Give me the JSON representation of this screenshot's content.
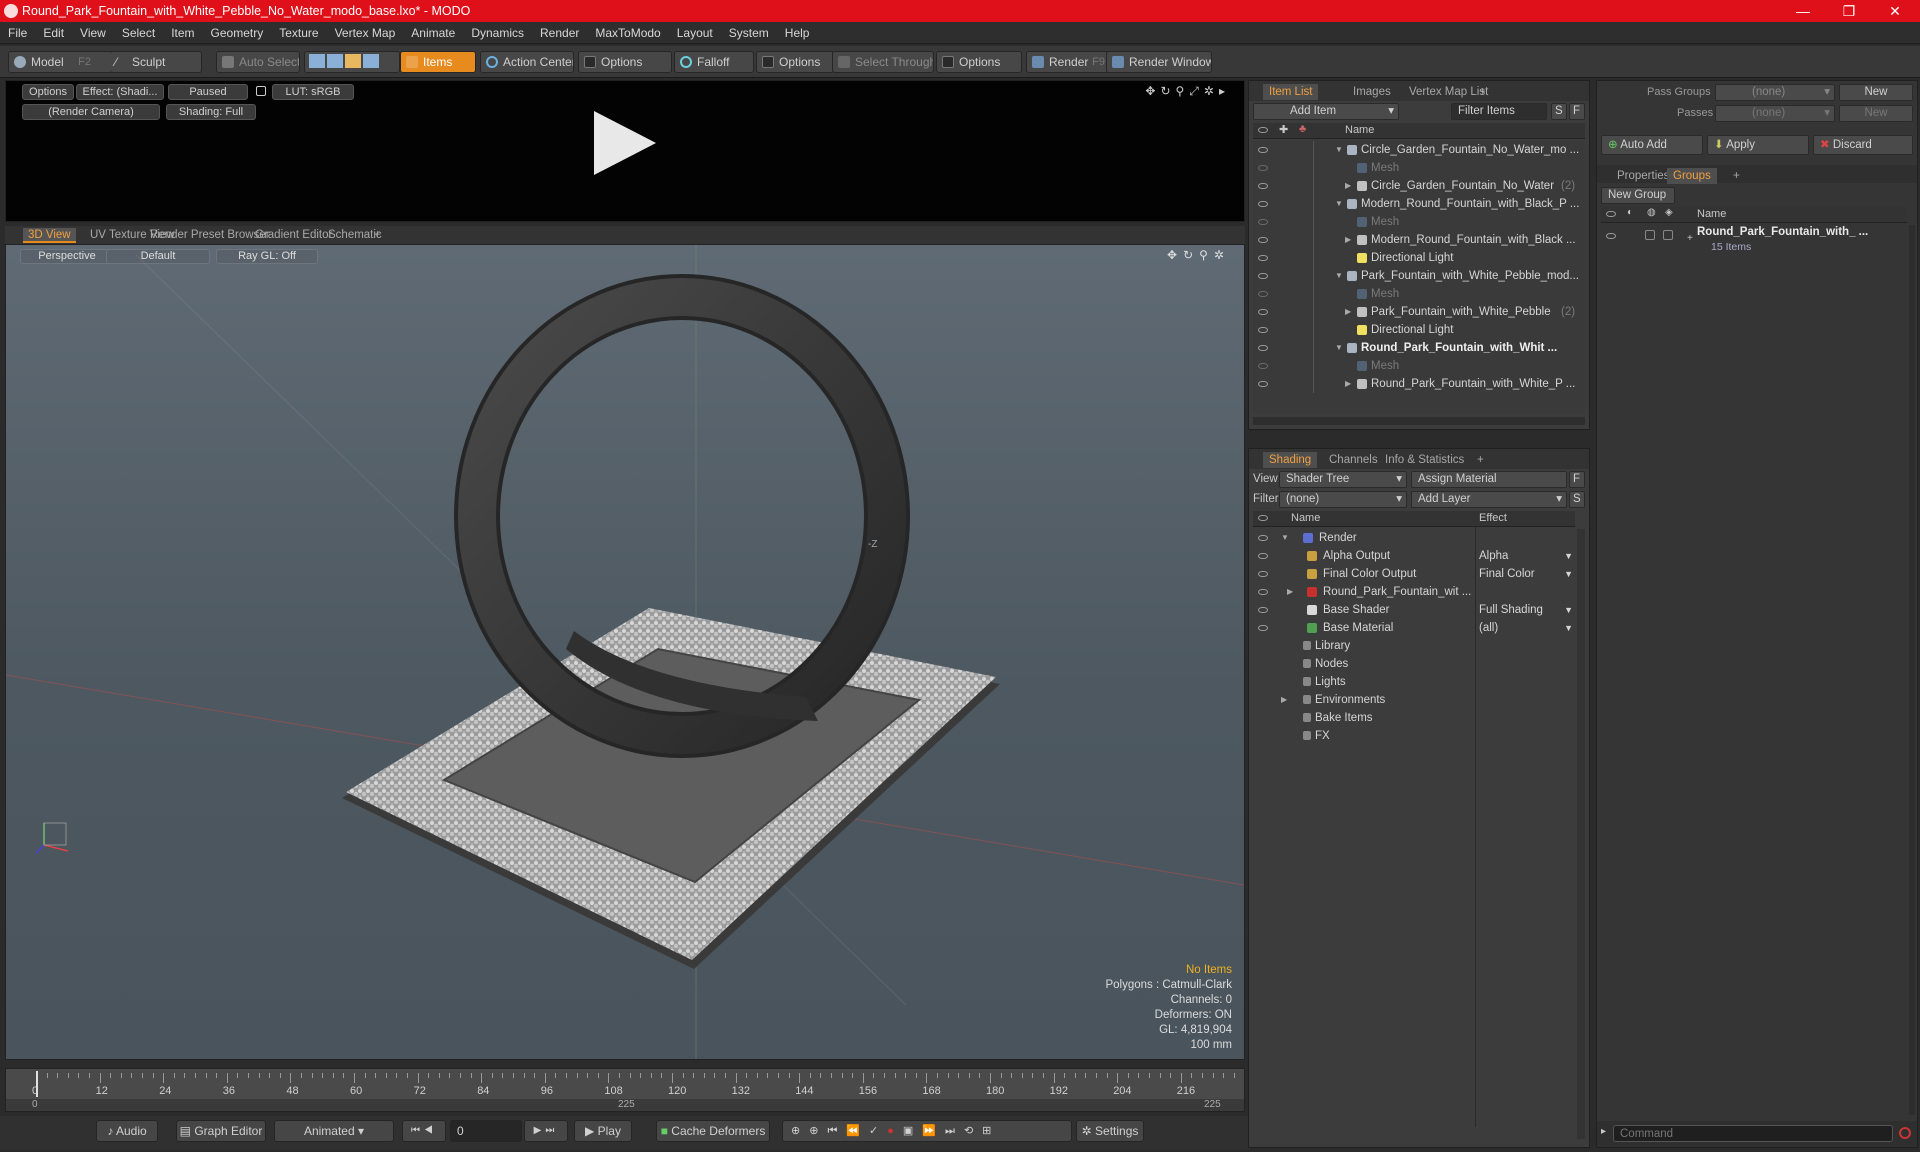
{
  "window": {
    "title": "Round_Park_Fountain_with_White_Pebble_No_Water_modo_base.lxo* - MODO",
    "minimize": "—",
    "maximize": "❐",
    "close": "✕"
  },
  "menu": [
    "File",
    "Edit",
    "View",
    "Select",
    "Item",
    "Geometry",
    "Texture",
    "Vertex Map",
    "Animate",
    "Dynamics",
    "Render",
    "MaxToModo",
    "Layout",
    "System",
    "Help"
  ],
  "toolbar": {
    "model": "Model",
    "model_key": "F2",
    "sculpt": "Sculpt",
    "auto_select": "Auto Select",
    "items": "Items",
    "action_center": "Action Center",
    "options1": "Options",
    "falloff": "Falloff",
    "options2": "Options",
    "select_through": "Select Through",
    "options3": "Options",
    "render": "Render",
    "render_key": "F9",
    "render_window": "Render Window"
  },
  "preview": {
    "options": "Options",
    "effect": "Effect: (Shadi...",
    "paused": "Paused",
    "lut": "LUT: sRGB",
    "camera": "(Render Camera)",
    "shading": "Shading: Full"
  },
  "viewport_tabs": [
    "3D View",
    "UV Texture View",
    "Render Preset Browser",
    "Gradient Editor",
    "Schematic",
    "+"
  ],
  "viewport": {
    "perspective": "Perspective",
    "default": "Default",
    "raygl": "Ray GL: Off",
    "axis_label": "-Z"
  },
  "stats": {
    "no_items": "No Items",
    "polygons": "Polygons : Catmull-Clark",
    "channels": "Channels: 0",
    "deformers": "Deformers: ON",
    "gl": "GL: 4,819,904",
    "scale": "100 mm"
  },
  "timeline": {
    "ticks": [
      "0",
      "12",
      "24",
      "36",
      "48",
      "60",
      "72",
      "84",
      "96",
      "108",
      "120",
      "132",
      "144",
      "156",
      "168",
      "180",
      "192",
      "204",
      "216"
    ],
    "start": "0",
    "mid": "225",
    "end": "225"
  },
  "bottom": {
    "audio": "Audio",
    "graph_editor": "Graph Editor",
    "animated": "Animated",
    "frame": "0",
    "play": "Play",
    "cache": "Cache Deformers",
    "settings": "Settings"
  },
  "item_list": {
    "tabs": [
      "Item List",
      "Images",
      "Vertex Map List",
      "+"
    ],
    "add_item": "Add Item",
    "filter": "Filter Items",
    "s": "S",
    "f": "F",
    "col_name": "Name",
    "rows": [
      {
        "label": "Circle_Garden_Fountain_No_Water_mo ...",
        "indent": 0,
        "kind": "scene",
        "exp": "▼"
      },
      {
        "label": "Mesh",
        "indent": 1,
        "kind": "mesh",
        "exp": ""
      },
      {
        "label": "Circle_Garden_Fountain_No_Water",
        "suffix": "(2)",
        "indent": 1,
        "kind": "loc",
        "exp": "▶"
      },
      {
        "label": "Modern_Round_Fountain_with_Black_P ...",
        "indent": 0,
        "kind": "scene",
        "exp": "▼"
      },
      {
        "label": "Mesh",
        "indent": 1,
        "kind": "mesh",
        "exp": ""
      },
      {
        "label": "Modern_Round_Fountain_with_Black ...",
        "indent": 1,
        "kind": "loc",
        "exp": "▶"
      },
      {
        "label": "Directional Light",
        "indent": 1,
        "kind": "light",
        "exp": ""
      },
      {
        "label": "Park_Fountain_with_White_Pebble_mod...",
        "indent": 0,
        "kind": "scene",
        "exp": "▼"
      },
      {
        "label": "Mesh",
        "indent": 1,
        "kind": "mesh",
        "exp": ""
      },
      {
        "label": "Park_Fountain_with_White_Pebble",
        "suffix": "(2)",
        "indent": 1,
        "kind": "loc",
        "exp": "▶"
      },
      {
        "label": "Directional Light",
        "indent": 1,
        "kind": "light",
        "exp": ""
      },
      {
        "label": "Round_Park_Fountain_with_Whit ...",
        "indent": 0,
        "kind": "scene",
        "exp": "▼",
        "bold": true
      },
      {
        "label": "Mesh",
        "indent": 1,
        "kind": "mesh",
        "exp": ""
      },
      {
        "label": "Round_Park_Fountain_with_White_P ...",
        "indent": 1,
        "kind": "loc",
        "exp": "▶"
      }
    ]
  },
  "shading": {
    "tabs": [
      "Shading",
      "Channels",
      "Info & Statistics",
      "+"
    ],
    "view_label": "View",
    "view_value": "Shader Tree",
    "assign_material": "Assign Material",
    "f": "F",
    "filter_label": "Filter",
    "filter_value": "(none)",
    "add_layer": "Add Layer",
    "s": "S",
    "col_name": "Name",
    "col_effect": "Effect",
    "rows": [
      {
        "label": "Render",
        "effect": "",
        "indent": 0,
        "color": "#5a6fd0",
        "exp": "▼"
      },
      {
        "label": "Alpha Output",
        "effect": "Alpha",
        "indent": 1,
        "color": "#c8a040",
        "exp": ""
      },
      {
        "label": "Final Color Output",
        "effect": "Final Color",
        "indent": 1,
        "color": "#c8a040",
        "exp": ""
      },
      {
        "label": "Round_Park_Fountain_wit ...",
        "effect": "",
        "indent": 1,
        "color": "#c83030",
        "exp": "▶"
      },
      {
        "label": "Base Shader",
        "effect": "Full Shading",
        "indent": 1,
        "color": "#d8d8d8",
        "exp": ""
      },
      {
        "label": "Base Material",
        "effect": "(all)",
        "indent": 1,
        "color": "#50a050",
        "exp": ""
      },
      {
        "label": "Library",
        "effect": "",
        "indent": 0,
        "color": "",
        "exp": ""
      },
      {
        "label": "Nodes",
        "effect": "",
        "indent": 0,
        "color": "",
        "exp": ""
      },
      {
        "label": "Lights",
        "effect": "",
        "indent": 0,
        "color": "",
        "exp": ""
      },
      {
        "label": "Environments",
        "effect": "",
        "indent": 0,
        "color": "",
        "exp": "▶"
      },
      {
        "label": "Bake Items",
        "effect": "",
        "indent": 0,
        "color": "",
        "exp": ""
      },
      {
        "label": "FX",
        "effect": "",
        "indent": 0,
        "color": "",
        "exp": ""
      }
    ]
  },
  "groups": {
    "pass_groups_label": "Pass Groups",
    "pass_groups_value": "(none)",
    "new1": "New",
    "passes_label": "Passes",
    "passes_value": "(none)",
    "new2": "New",
    "auto_add": "Auto Add",
    "apply": "Apply",
    "discard": "Discard",
    "tabs": [
      "Properties",
      "Groups",
      "+"
    ],
    "new_group": "New Group",
    "col_name": "Name",
    "group_name": "Round_Park_Fountain_with_ ...",
    "group_count": "15 Items"
  },
  "command": {
    "placeholder": "Command"
  }
}
